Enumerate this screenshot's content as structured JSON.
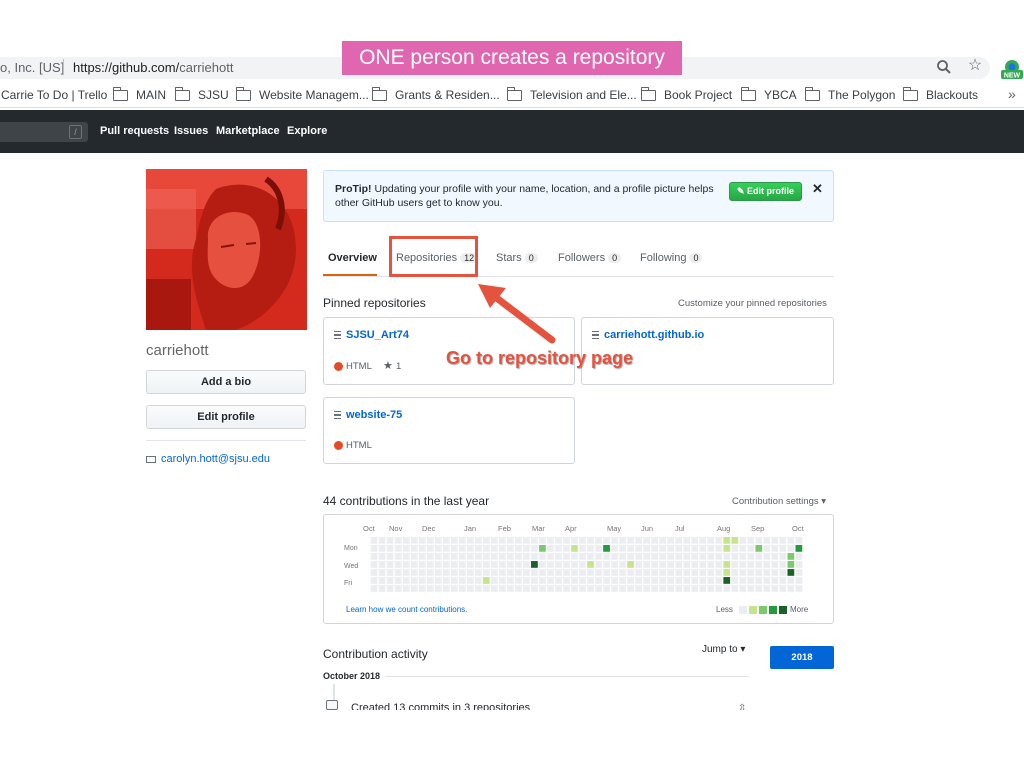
{
  "slide": {
    "caption": "ONE person creates a repository"
  },
  "browser": {
    "site_identity": "o, Inc. [US]",
    "url_prefix": "https://github.com/",
    "url_path": "carriehott",
    "ext_badge": "NEW"
  },
  "bookmarks": [
    {
      "label": "Carrie To Do | Trello",
      "folder": false
    },
    {
      "label": "MAIN",
      "folder": true
    },
    {
      "label": "SJSU",
      "folder": true
    },
    {
      "label": "Website Managem...",
      "folder": true
    },
    {
      "label": "Grants & Residen...",
      "folder": true
    },
    {
      "label": "Television and Ele...",
      "folder": true
    },
    {
      "label": "Book Project",
      "folder": true
    },
    {
      "label": "YBCA",
      "folder": true
    },
    {
      "label": "The Polygon",
      "folder": true
    },
    {
      "label": "Blackouts",
      "folder": true
    }
  ],
  "bookmarks_more": "»",
  "gh_nav": {
    "search_key": "/",
    "items": [
      "Pull requests",
      "Issues",
      "Marketplace",
      "Explore"
    ]
  },
  "profile": {
    "username": "carriehott",
    "add_bio": "Add a bio",
    "edit_profile": "Edit profile",
    "email": "carolyn.hott@sjsu.edu"
  },
  "protip": {
    "bold": "ProTip!",
    "text": " Updating your profile with your name, location, and a profile picture helps other GitHub users get to know you.",
    "button": "Edit profile",
    "close": "✕"
  },
  "tabs": [
    {
      "label": "Overview",
      "count": null
    },
    {
      "label": "Repositories",
      "count": "12"
    },
    {
      "label": "Stars",
      "count": "0"
    },
    {
      "label": "Followers",
      "count": "0"
    },
    {
      "label": "Following",
      "count": "0"
    }
  ],
  "pinned": {
    "title": "Pinned repositories",
    "customize": "Customize your pinned repositories",
    "repos": [
      {
        "name": "SJSU_Art74",
        "language": "HTML",
        "stars": "1"
      },
      {
        "name": "carriehott.github.io",
        "language": "",
        "stars": ""
      },
      {
        "name": "website-75",
        "language": "HTML",
        "stars": ""
      }
    ]
  },
  "annotation": {
    "text": "Go to repository page"
  },
  "contributions": {
    "title": "44 contributions in the last year",
    "settings": "Contribution settings ▾",
    "months": [
      "Oct",
      "Nov",
      "Dec",
      "Jan",
      "Feb",
      "Mar",
      "Apr",
      "May",
      "Jun",
      "Jul",
      "Aug",
      "Sep",
      "Oct"
    ],
    "days": [
      "Mon",
      "Wed",
      "Fri"
    ],
    "learn": "Learn how we count contributions.",
    "less": "Less",
    "more": "More",
    "colors": [
      "#ebedf0",
      "#c6e48b",
      "#7bc96f",
      "#239a3b",
      "#196127"
    ]
  },
  "activity": {
    "title": "Contribution activity",
    "jump": "Jump to ▾",
    "year": "2018",
    "month": "October 2018",
    "created": "Created 13 commits in 3 repositories"
  }
}
